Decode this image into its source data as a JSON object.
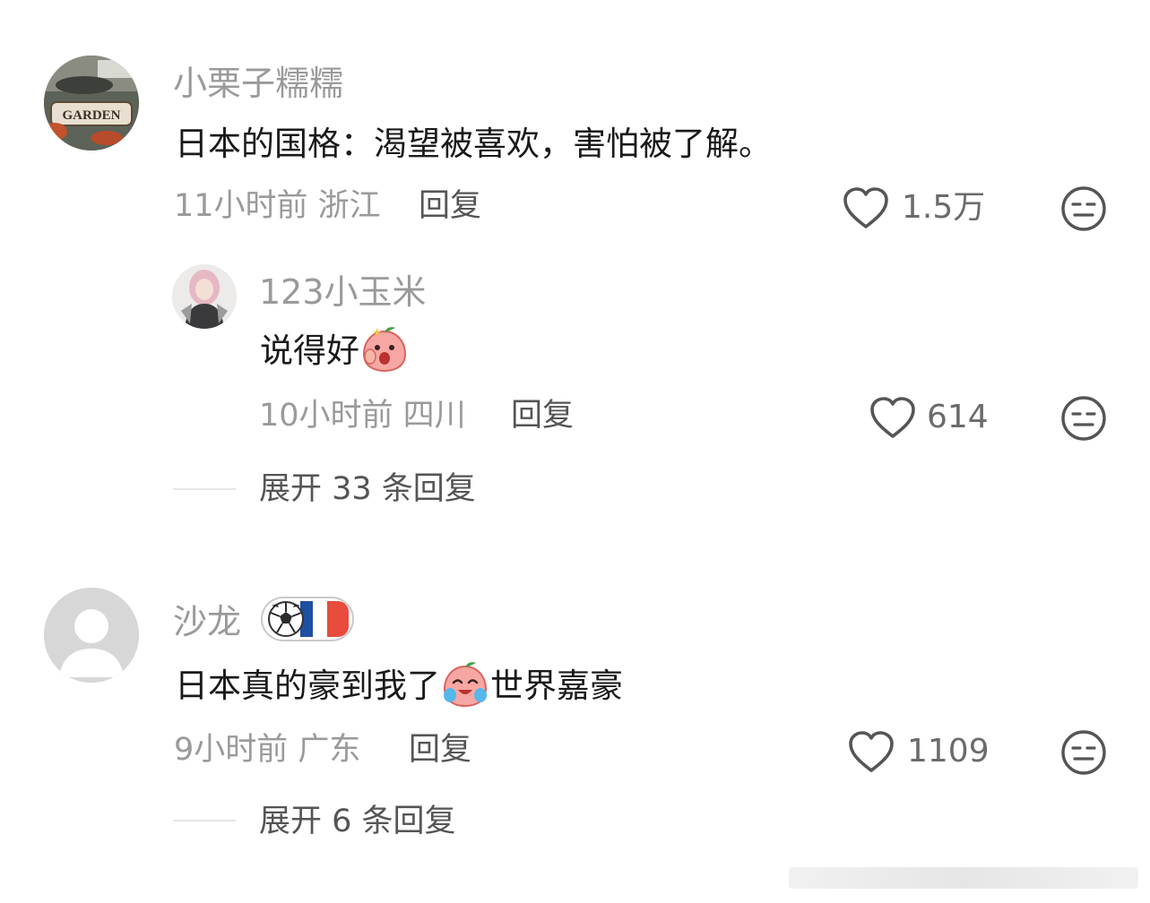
{
  "comments": [
    {
      "username": "小栗子糯糯",
      "avatar_text": "GARDEN",
      "content": "日本的国格：渴望被喜欢，害怕被了解。",
      "time_location": "11小时前 浙江",
      "reply_label": "回复",
      "likes": "1.5万",
      "replies": [
        {
          "username": "123小玉米",
          "content": "说得好",
          "time_location": "10小时前 四川",
          "reply_label": "回复",
          "likes": "614"
        }
      ],
      "expand_label": "展开 33 条回复"
    },
    {
      "username": "沙龙",
      "content_before": "日本真的豪到我了",
      "content_after": "世界嘉豪",
      "time_location": "9小时前 广东",
      "reply_label": "回复",
      "likes": "1109",
      "expand_label": "展开 6 条回复"
    }
  ],
  "icons": {
    "like": "heart-outline-icon",
    "dislike": "neutral-face-icon"
  },
  "colors": {
    "text_primary": "#1a1a1a",
    "text_secondary": "#9a9a9a",
    "badge_red": "#e94b3c",
    "badge_blue": "#1f4fa3"
  }
}
